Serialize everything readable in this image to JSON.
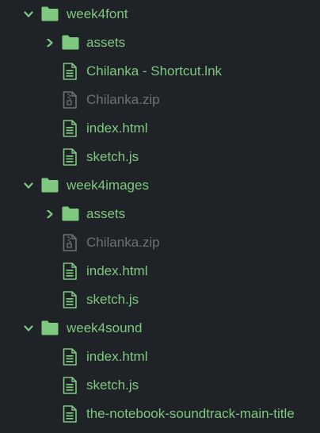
{
  "colors": {
    "background": "#1f2327",
    "tracked": "#7ec87f",
    "ignored": "#6d7175"
  },
  "tree": {
    "folder_week4font": {
      "label": "week4font",
      "expanded": true,
      "icon": "folder-icon"
    },
    "font_assets": {
      "label": "assets",
      "expanded": false,
      "icon": "folder-icon"
    },
    "font_shortcut": {
      "label": "Chilanka - Shortcut.lnk",
      "icon": "file-text-icon"
    },
    "font_zip": {
      "label": "Chilanka.zip",
      "icon": "zip-file-icon",
      "ignored": true
    },
    "font_index": {
      "label": "index.html",
      "icon": "file-text-icon"
    },
    "font_sketch": {
      "label": "sketch.js",
      "icon": "file-text-icon"
    },
    "folder_week4images": {
      "label": "week4images",
      "expanded": true,
      "icon": "folder-icon"
    },
    "images_assets": {
      "label": "assets",
      "expanded": false,
      "icon": "folder-icon"
    },
    "images_zip": {
      "label": "Chilanka.zip",
      "icon": "zip-file-icon",
      "ignored": true
    },
    "images_index": {
      "label": "index.html",
      "icon": "file-text-icon"
    },
    "images_sketch": {
      "label": "sketch.js",
      "icon": "file-text-icon"
    },
    "folder_week4sound": {
      "label": "week4sound",
      "expanded": true,
      "icon": "folder-icon"
    },
    "sound_index": {
      "label": "index.html",
      "icon": "file-text-icon"
    },
    "sound_sketch": {
      "label": "sketch.js",
      "icon": "file-text-icon"
    },
    "sound_track": {
      "label": "the-notebook-soundtrack-main-title",
      "icon": "file-text-icon"
    }
  }
}
